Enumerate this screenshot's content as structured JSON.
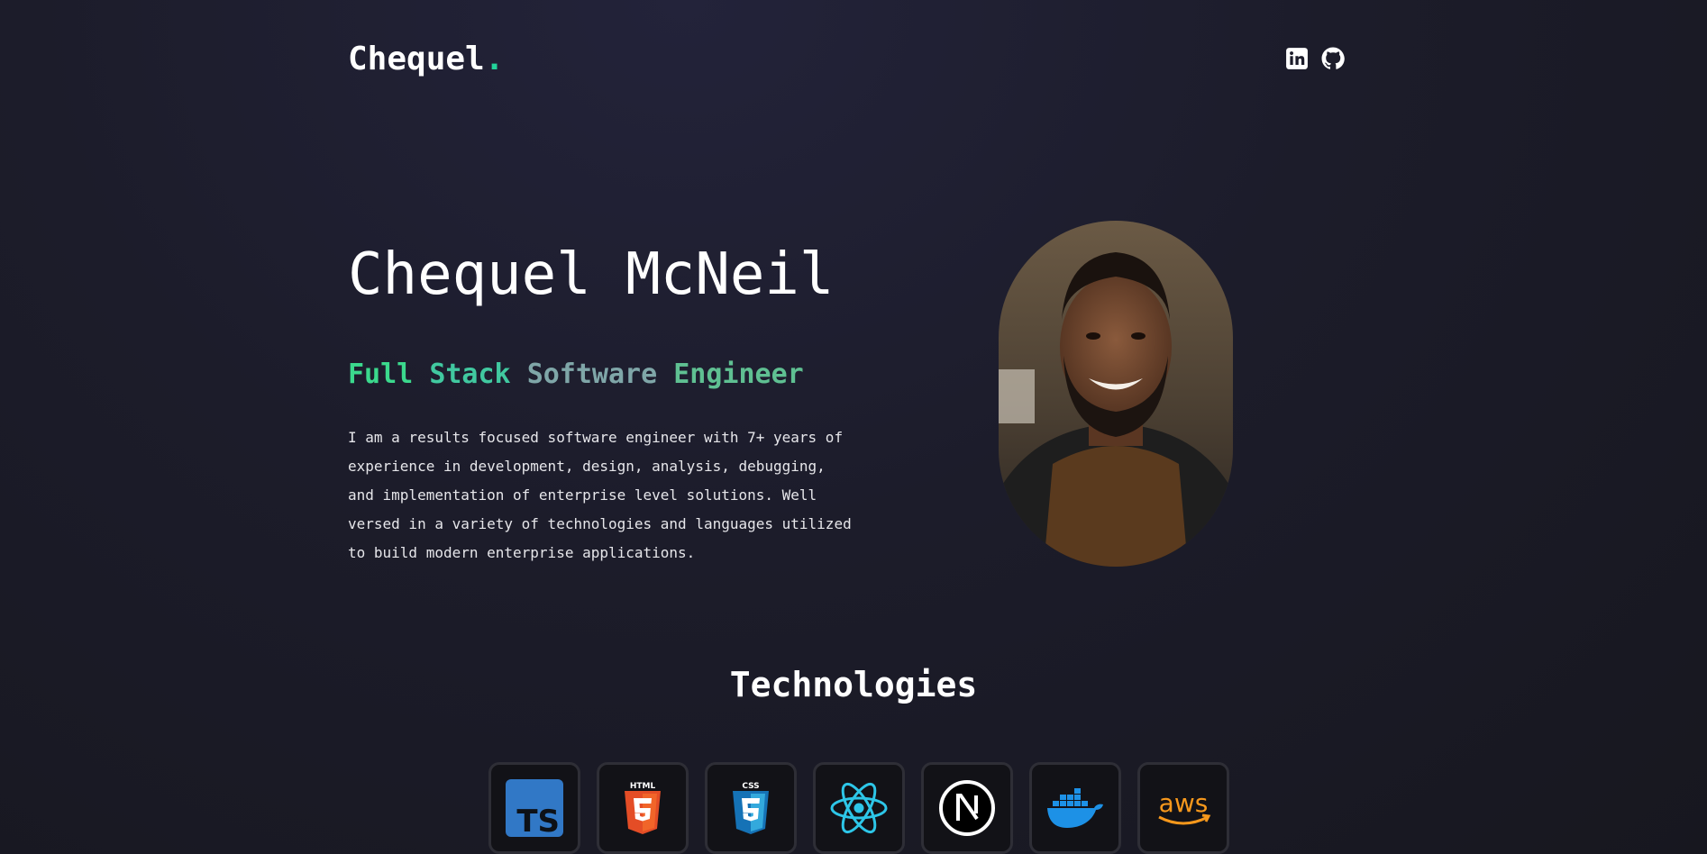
{
  "header": {
    "logo_text": "Chequel",
    "logo_dot": ".",
    "socials": [
      {
        "icon": "linkedin-icon"
      },
      {
        "icon": "github-icon"
      }
    ]
  },
  "hero": {
    "name": "Chequel McNeil",
    "title_words": [
      "Full",
      "Stack",
      "Software",
      "Engineer"
    ],
    "description": "I am a results focused software engineer with 7+ years of experience in development, design, analysis, debugging, and implementation of enterprise level solutions. Well versed in a variety of technologies and languages utilized to build modern enterprise applications.",
    "portrait_icon": "portrait-photo"
  },
  "technologies": {
    "title": "Technologies",
    "items": [
      {
        "icon": "typescript-icon"
      },
      {
        "icon": "html5-icon"
      },
      {
        "icon": "css3-icon"
      },
      {
        "icon": "react-icon"
      },
      {
        "icon": "nextjs-icon"
      },
      {
        "icon": "docker-icon"
      },
      {
        "icon": "aws-icon"
      }
    ]
  },
  "colors": {
    "accent": "#22d39a",
    "background": "#1c1c2a"
  }
}
